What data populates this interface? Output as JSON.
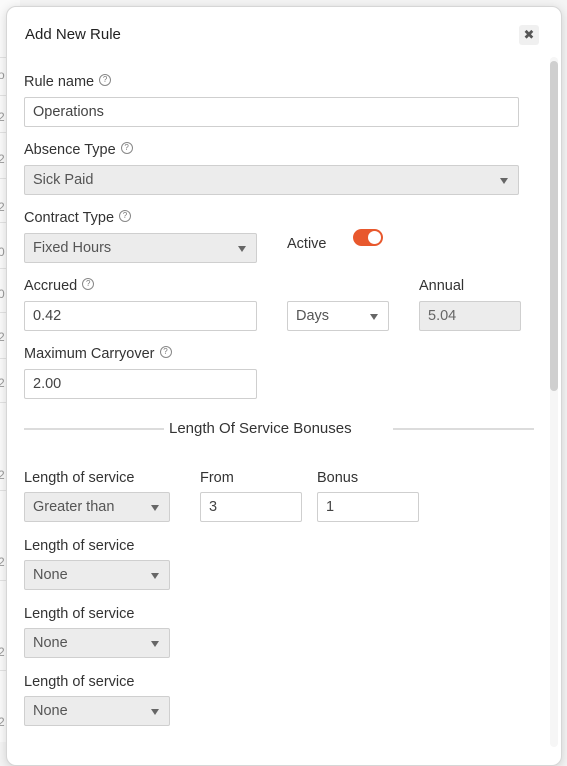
{
  "modal": {
    "title": "Add New Rule",
    "close_icon": "close-icon",
    "help_glyph": "?"
  },
  "form": {
    "rule_name": {
      "label": "Rule name",
      "value": "Operations"
    },
    "absence_type": {
      "label": "Absence Type",
      "value": "Sick Paid"
    },
    "contract_type": {
      "label": "Contract Type",
      "value": "Fixed Hours"
    },
    "active": {
      "label": "Active",
      "on": true,
      "color": "#e8582d"
    },
    "accrued": {
      "label": "Accrued",
      "value": "0.42",
      "unit": "Days"
    },
    "annual": {
      "label": "Annual",
      "value": "5.04"
    },
    "max_carryover": {
      "label": "Maximum Carryover",
      "value": "2.00"
    }
  },
  "los_section": {
    "title": "Length Of Service Bonuses",
    "from_label": "From",
    "bonus_label": "Bonus",
    "rows": [
      {
        "label": "Length of service",
        "condition": "Greater than",
        "from": "3",
        "bonus": "1"
      },
      {
        "label": "Length of service",
        "condition": "None"
      },
      {
        "label": "Length of service",
        "condition": "None"
      },
      {
        "label": "Length of service",
        "condition": "None"
      }
    ]
  },
  "background": {
    "row_glyphs": [
      "o",
      "2",
      "2",
      "2",
      "0",
      "0",
      "2",
      "2",
      "2",
      "2",
      "2",
      "2"
    ]
  }
}
